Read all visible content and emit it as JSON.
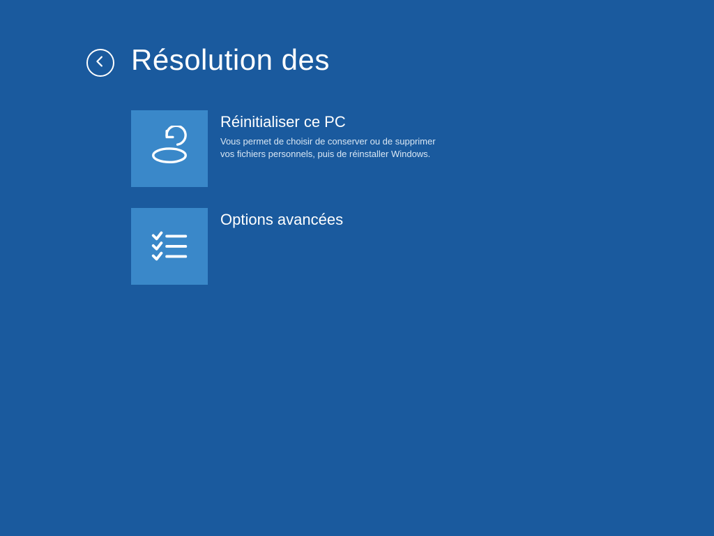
{
  "header": {
    "title": "Résolution des"
  },
  "options": {
    "reset": {
      "title": "Réinitialiser ce PC",
      "description": "Vous permet de choisir de conserver ou de supprimer vos fichiers personnels, puis de réinstaller Windows."
    },
    "advanced": {
      "title": "Options avancées",
      "description": ""
    }
  }
}
